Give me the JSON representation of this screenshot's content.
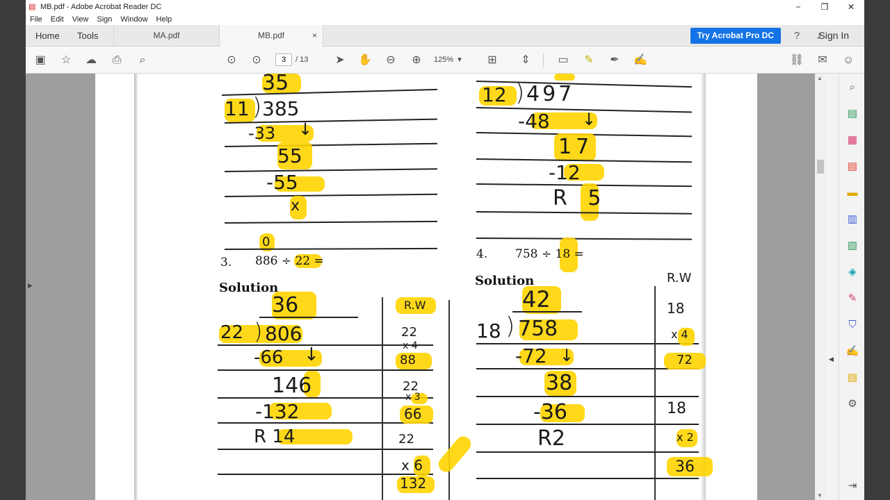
{
  "window": {
    "title": "MB.pdf - Adobe Acrobat Reader DC",
    "controls": {
      "minimize": "−",
      "restore": "❐",
      "close": "✕"
    }
  },
  "menu": [
    "File",
    "Edit",
    "View",
    "Sign",
    "Window",
    "Help"
  ],
  "tabs": {
    "home": "Home",
    "tools": "Tools",
    "docs": [
      {
        "label": "MA.pdf",
        "active": false
      },
      {
        "label": "MB.pdf",
        "active": true,
        "close": "×"
      }
    ],
    "try_button": "Try Acrobat Pro DC",
    "sign_in": "Sign In"
  },
  "toolbar": {
    "current_page": "3",
    "page_total": "/ 13",
    "zoom": "125%"
  },
  "colors": {
    "accent": "#1473e6",
    "highlight": "#ffd400",
    "page_bg": "#ffffff"
  },
  "worksheet": {
    "left_top": {
      "quotient": "35",
      "divisor": "11",
      "dividend": "385",
      "steps": [
        "-33",
        "55",
        "-55",
        "x"
      ]
    },
    "right_top": {
      "divisor": "12",
      "dividend": "497",
      "steps": [
        "-48",
        "17",
        "-12",
        "R 5"
      ]
    },
    "problem3": {
      "number": "3.",
      "expression": "886 ÷ 22 =",
      "above": "0"
    },
    "problem4": {
      "number": "4.",
      "expression": "758 ÷ 18 ="
    },
    "solution_label": "Solution",
    "p3_work": {
      "quotient": "36",
      "divisor": "22",
      "dividend": "806",
      "steps": [
        "-66",
        "146",
        "-132",
        "R 14"
      ]
    },
    "p3_rough": {
      "header": "R.W",
      "items": [
        "22",
        "x 4",
        "88",
        "22",
        "x 3",
        "66",
        "22",
        "x 6",
        "132"
      ]
    },
    "p4_work": {
      "quotient": "42",
      "divisor": "18",
      "dividend": "758",
      "steps": [
        "-72",
        "38",
        "-36",
        "R2"
      ]
    },
    "p4_rough": {
      "header": "R.W",
      "items": [
        "18",
        "x 4",
        "72",
        "18",
        "x 2",
        "36"
      ]
    }
  }
}
